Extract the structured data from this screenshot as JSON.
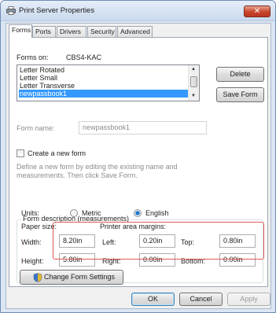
{
  "window": {
    "title": "Print Server Properties",
    "close_glyph": "✕"
  },
  "tabs": [
    {
      "label": "Forms",
      "active": true
    },
    {
      "label": "Ports",
      "active": false
    },
    {
      "label": "Drivers",
      "active": false
    },
    {
      "label": "Security",
      "active": false
    },
    {
      "label": "Advanced",
      "active": false
    }
  ],
  "forms_on": {
    "label": "Forms on:",
    "server": "CBS4-KAC"
  },
  "forms_list": {
    "items": [
      "Letter Rotated",
      "Letter Small",
      "Letter Transverse",
      "newpassbook1"
    ],
    "selected_index": 3
  },
  "buttons": {
    "delete": "Delete",
    "save_form": "Save Form",
    "change_form_settings": "Change Form Settings",
    "ok": "OK",
    "cancel": "Cancel",
    "apply": "Apply"
  },
  "form_name": {
    "label": "Form name:",
    "value": "newpassbook1"
  },
  "create_new": {
    "label": "Create a new form",
    "checked": false,
    "help_line1": "Define a new form by editing the existing name and",
    "help_line2": "measurements. Then click Save Form."
  },
  "description": {
    "legend": "Form description (measurements)",
    "units_label": "Units:",
    "metric": "Metric",
    "english": "English",
    "selected_unit": "English",
    "paper_size_label": "Paper size:",
    "margins_label": "Printer area margins:",
    "width_label": "Width:",
    "width": "8.20in",
    "height_label": "Height:",
    "height": "5.80in",
    "left_label": "Left:",
    "left": "0.20in",
    "right_label": "Right:",
    "right": "0.00in",
    "top_label": "Top:",
    "top": "0.80in",
    "bottom_label": "Bottom:",
    "bottom": "0.00in"
  },
  "colors": {
    "selection": "#3399ff",
    "highlight_box": "#e0585a",
    "close_button": "#c8452c"
  }
}
